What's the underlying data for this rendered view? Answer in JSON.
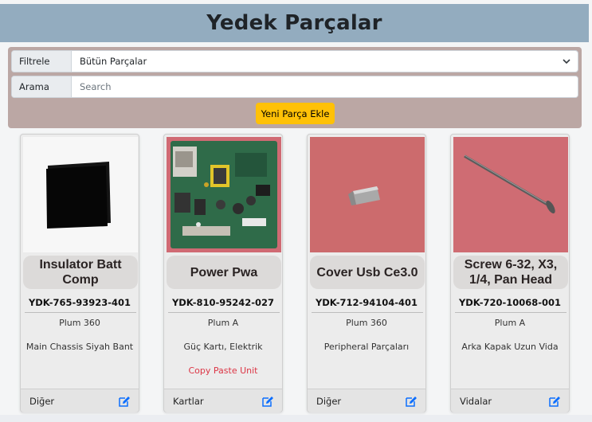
{
  "header": {
    "title": "Yedek Parçalar"
  },
  "filter": {
    "filter_label": "Filtrele",
    "filter_value": "Bütün Parçalar",
    "search_label": "Arama",
    "search_placeholder": "Search",
    "add_button_label": "Yeni Parça Ekle"
  },
  "colors": {
    "header_bg": "#93acbf",
    "panel_bg": "#bba7a4",
    "add_button": "#ffc107",
    "edit_icon": "#0d6efd",
    "note": "#dc3545"
  },
  "cards": [
    {
      "title": "Insulator Batt Comp",
      "code": "YDK-765-93923-401",
      "model": "Plum 360",
      "description": "Main Chassis Siyah Bant",
      "note": "",
      "category": "Diğer",
      "image": "black-insulator-pad"
    },
    {
      "title": "Power Pwa",
      "code": "YDK-810-95242-027",
      "model": "Plum A",
      "description": "Güç Kartı, Elektrik",
      "note": "Copy Paste Unit",
      "category": "Kartlar",
      "image": "green-power-circuit-board"
    },
    {
      "title": "Cover Usb Ce3.0",
      "code": "YDK-712-94104-401",
      "model": "Plum 360",
      "description": "Peripheral Parçaları",
      "note": "",
      "category": "Diğer",
      "image": "metal-usb-cover-on-red"
    },
    {
      "title": "Screw 6-32, X3, 1/4, Pan Head",
      "code": "YDK-720-10068-001",
      "model": "Plum A",
      "description": "Arka Kapak Uzun Vida",
      "note": "",
      "category": "Vidalar",
      "image": "long-screw-on-red"
    }
  ],
  "icons": {
    "dropdown": "chevron-down-icon",
    "edit": "edit-icon"
  }
}
